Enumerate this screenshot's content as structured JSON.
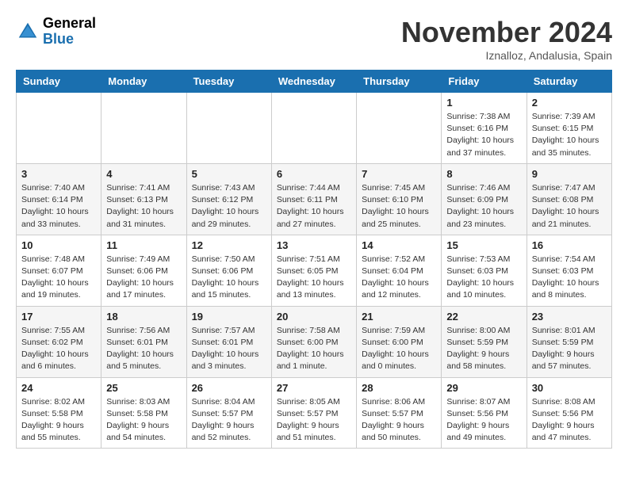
{
  "header": {
    "logo_line1": "General",
    "logo_line2": "Blue",
    "month": "November 2024",
    "location": "Iznalloz, Andalusia, Spain"
  },
  "weekdays": [
    "Sunday",
    "Monday",
    "Tuesday",
    "Wednesday",
    "Thursday",
    "Friday",
    "Saturday"
  ],
  "weeks": [
    [
      {
        "day": "",
        "info": ""
      },
      {
        "day": "",
        "info": ""
      },
      {
        "day": "",
        "info": ""
      },
      {
        "day": "",
        "info": ""
      },
      {
        "day": "",
        "info": ""
      },
      {
        "day": "1",
        "info": "Sunrise: 7:38 AM\nSunset: 6:16 PM\nDaylight: 10 hours\nand 37 minutes."
      },
      {
        "day": "2",
        "info": "Sunrise: 7:39 AM\nSunset: 6:15 PM\nDaylight: 10 hours\nand 35 minutes."
      }
    ],
    [
      {
        "day": "3",
        "info": "Sunrise: 7:40 AM\nSunset: 6:14 PM\nDaylight: 10 hours\nand 33 minutes."
      },
      {
        "day": "4",
        "info": "Sunrise: 7:41 AM\nSunset: 6:13 PM\nDaylight: 10 hours\nand 31 minutes."
      },
      {
        "day": "5",
        "info": "Sunrise: 7:43 AM\nSunset: 6:12 PM\nDaylight: 10 hours\nand 29 minutes."
      },
      {
        "day": "6",
        "info": "Sunrise: 7:44 AM\nSunset: 6:11 PM\nDaylight: 10 hours\nand 27 minutes."
      },
      {
        "day": "7",
        "info": "Sunrise: 7:45 AM\nSunset: 6:10 PM\nDaylight: 10 hours\nand 25 minutes."
      },
      {
        "day": "8",
        "info": "Sunrise: 7:46 AM\nSunset: 6:09 PM\nDaylight: 10 hours\nand 23 minutes."
      },
      {
        "day": "9",
        "info": "Sunrise: 7:47 AM\nSunset: 6:08 PM\nDaylight: 10 hours\nand 21 minutes."
      }
    ],
    [
      {
        "day": "10",
        "info": "Sunrise: 7:48 AM\nSunset: 6:07 PM\nDaylight: 10 hours\nand 19 minutes."
      },
      {
        "day": "11",
        "info": "Sunrise: 7:49 AM\nSunset: 6:06 PM\nDaylight: 10 hours\nand 17 minutes."
      },
      {
        "day": "12",
        "info": "Sunrise: 7:50 AM\nSunset: 6:06 PM\nDaylight: 10 hours\nand 15 minutes."
      },
      {
        "day": "13",
        "info": "Sunrise: 7:51 AM\nSunset: 6:05 PM\nDaylight: 10 hours\nand 13 minutes."
      },
      {
        "day": "14",
        "info": "Sunrise: 7:52 AM\nSunset: 6:04 PM\nDaylight: 10 hours\nand 12 minutes."
      },
      {
        "day": "15",
        "info": "Sunrise: 7:53 AM\nSunset: 6:03 PM\nDaylight: 10 hours\nand 10 minutes."
      },
      {
        "day": "16",
        "info": "Sunrise: 7:54 AM\nSunset: 6:03 PM\nDaylight: 10 hours\nand 8 minutes."
      }
    ],
    [
      {
        "day": "17",
        "info": "Sunrise: 7:55 AM\nSunset: 6:02 PM\nDaylight: 10 hours\nand 6 minutes."
      },
      {
        "day": "18",
        "info": "Sunrise: 7:56 AM\nSunset: 6:01 PM\nDaylight: 10 hours\nand 5 minutes."
      },
      {
        "day": "19",
        "info": "Sunrise: 7:57 AM\nSunset: 6:01 PM\nDaylight: 10 hours\nand 3 minutes."
      },
      {
        "day": "20",
        "info": "Sunrise: 7:58 AM\nSunset: 6:00 PM\nDaylight: 10 hours\nand 1 minute."
      },
      {
        "day": "21",
        "info": "Sunrise: 7:59 AM\nSunset: 6:00 PM\nDaylight: 10 hours\nand 0 minutes."
      },
      {
        "day": "22",
        "info": "Sunrise: 8:00 AM\nSunset: 5:59 PM\nDaylight: 9 hours\nand 58 minutes."
      },
      {
        "day": "23",
        "info": "Sunrise: 8:01 AM\nSunset: 5:59 PM\nDaylight: 9 hours\nand 57 minutes."
      }
    ],
    [
      {
        "day": "24",
        "info": "Sunrise: 8:02 AM\nSunset: 5:58 PM\nDaylight: 9 hours\nand 55 minutes."
      },
      {
        "day": "25",
        "info": "Sunrise: 8:03 AM\nSunset: 5:58 PM\nDaylight: 9 hours\nand 54 minutes."
      },
      {
        "day": "26",
        "info": "Sunrise: 8:04 AM\nSunset: 5:57 PM\nDaylight: 9 hours\nand 52 minutes."
      },
      {
        "day": "27",
        "info": "Sunrise: 8:05 AM\nSunset: 5:57 PM\nDaylight: 9 hours\nand 51 minutes."
      },
      {
        "day": "28",
        "info": "Sunrise: 8:06 AM\nSunset: 5:57 PM\nDaylight: 9 hours\nand 50 minutes."
      },
      {
        "day": "29",
        "info": "Sunrise: 8:07 AM\nSunset: 5:56 PM\nDaylight: 9 hours\nand 49 minutes."
      },
      {
        "day": "30",
        "info": "Sunrise: 8:08 AM\nSunset: 5:56 PM\nDaylight: 9 hours\nand 47 minutes."
      }
    ]
  ]
}
